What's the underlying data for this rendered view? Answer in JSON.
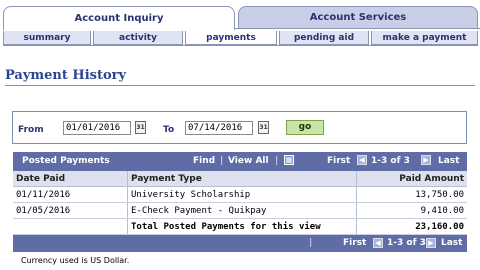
{
  "tabs": {
    "main": [
      {
        "label": "Account Inquiry",
        "active": true
      },
      {
        "label": "Account Services",
        "active": false
      }
    ],
    "sub": [
      {
        "label": "summary",
        "active": false
      },
      {
        "label": "activity",
        "active": false
      },
      {
        "label": "payments",
        "active": true
      },
      {
        "label": "pending aid",
        "active": false
      },
      {
        "label": "make a payment",
        "active": false
      }
    ]
  },
  "page_title": "Payment History",
  "filter": {
    "from_label": "From",
    "from_value": "01/01/2016",
    "to_label": "To",
    "to_value": "07/14/2016",
    "go_label": "go",
    "calendar_glyph": "31"
  },
  "grid": {
    "title": "Posted Payments",
    "find_label": "Find",
    "separator": "|",
    "view_all_label": "View All",
    "first_label": "First",
    "last_label": "Last",
    "range_text": "1-3 of 3",
    "columns": [
      "Date Paid",
      "Payment Type",
      "Paid Amount"
    ],
    "rows": [
      {
        "date": "01/11/2016",
        "type": "University Scholarship",
        "amount": "13,750.00"
      },
      {
        "date": "01/05/2016",
        "type": "E-Check Payment - Quikpay",
        "amount": "9,410.00"
      }
    ],
    "total": {
      "label": "Total Posted Payments for this view",
      "amount": "23,160.00"
    }
  },
  "currency_note": "Currency used is US Dollar.",
  "colors": {
    "header_bar": "#5f6ca6",
    "column_head_bg": "#dde1ee",
    "title_text": "#2a4590",
    "go_button": "#c7e6a6"
  }
}
